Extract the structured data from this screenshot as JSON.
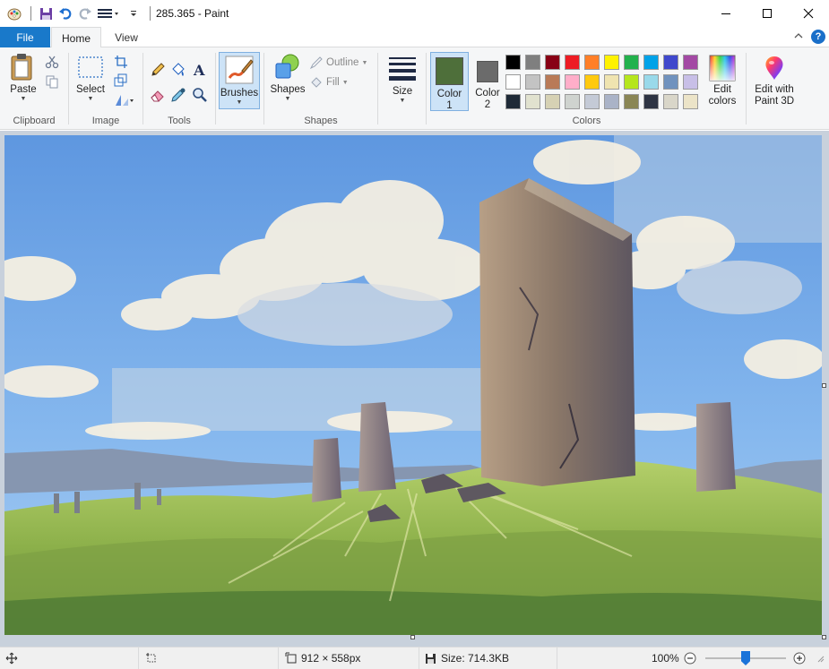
{
  "window": {
    "title": "285.365 - Paint",
    "controls": [
      "minimize",
      "maximize",
      "close"
    ]
  },
  "tabs": {
    "file": "File",
    "home": "Home",
    "view": "View"
  },
  "ribbon": {
    "clipboard": {
      "label": "Clipboard",
      "paste": "Paste"
    },
    "image": {
      "label": "Image",
      "select": "Select"
    },
    "tools": {
      "label": "Tools"
    },
    "brushes": {
      "label": "Brushes"
    },
    "shapes": {
      "label": "Shapes",
      "shapes_btn": "Shapes",
      "outline": "Outline",
      "fill": "Fill"
    },
    "size": {
      "label": "Size"
    },
    "colors": {
      "label": "Colors",
      "color1_line1": "Color",
      "color1_line2": "1",
      "color2_line1": "Color",
      "color2_line2": "2",
      "edit_line1": "Edit",
      "edit_line2": "colors",
      "color1": "#4e6f3a",
      "color2": "#6b6b6b",
      "palette": [
        [
          "#000000",
          "#7f7f7f",
          "#880015",
          "#ed1c24",
          "#ff7f27",
          "#fff200",
          "#22b14c",
          "#00a2e8",
          "#3f48cc",
          "#a349a4"
        ],
        [
          "#ffffff",
          "#c3c3c3",
          "#b97a57",
          "#ffaec9",
          "#ffc90e",
          "#efe4b0",
          "#b5e61d",
          "#99d9ea",
          "#7092be",
          "#c8bfe7"
        ],
        [
          "#1f2a37",
          "#e1e2cf",
          "#d6d1b4",
          "#cfd3cf",
          "#c4cad6",
          "#aab3c7",
          "#8a8655",
          "#2e3443",
          "#d9d6c9",
          "#ece4c8"
        ]
      ]
    },
    "paint3d": {
      "line1": "Edit with",
      "line2": "Paint 3D"
    }
  },
  "status": {
    "dimensions": "912 × 558px",
    "size": "Size: 714.3KB",
    "zoom": "100%",
    "zoom_level": 0.5
  }
}
